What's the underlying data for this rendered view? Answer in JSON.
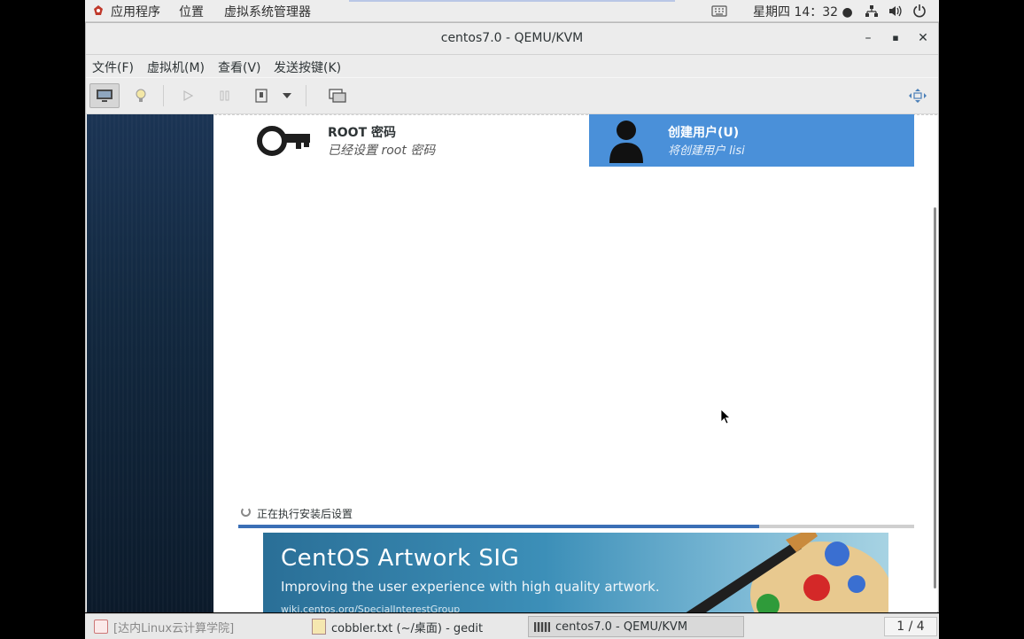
{
  "top_panel": {
    "apps_label": "应用程序",
    "places_label": "位置",
    "vm_manager_label": "虚拟系统管理器",
    "clock": "星期四 14：32 ●"
  },
  "window": {
    "title": "centos7.0 - QEMU/KVM",
    "minimize": "–",
    "maximize": "▪",
    "close": "✕"
  },
  "menubar": {
    "items": [
      "文件(F)",
      "虚拟机(M)",
      "查看(V)",
      "发送按键(K)"
    ]
  },
  "installer": {
    "root_spoke": {
      "title": "ROOT 密码",
      "status": "已经设置 root 密码"
    },
    "user_spoke": {
      "title": "创建用户(U)",
      "status": "将创建用户 lisi"
    },
    "progress": {
      "label": "正在执行安装后设置",
      "value": 0.77
    },
    "banner": {
      "title": "CentOS Artwork SIG",
      "subtitle": "Improving the user experience with high quality artwork.",
      "url": "wiki.centos.org/SpecialInterestGroup"
    }
  },
  "taskbar": {
    "tasks": [
      "[达内Linux云计算学院]",
      "cobbler.txt (~/桌面) - gedit",
      "centos7.0 - QEMU/KVM"
    ],
    "pager": "1 / 4"
  },
  "colors": {
    "accent": "#4a90d9",
    "progress": "#3b6fb6"
  }
}
